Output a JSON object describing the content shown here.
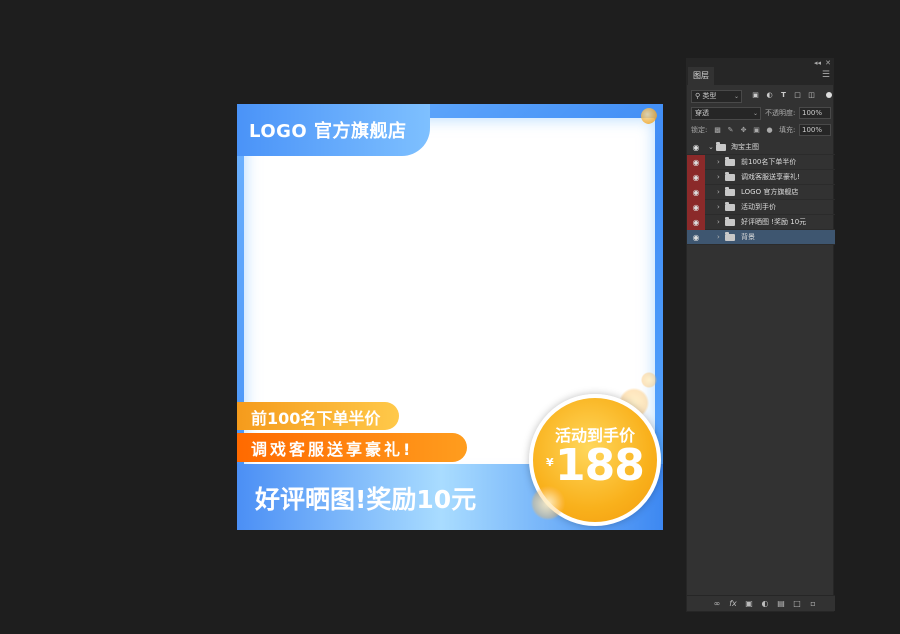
{
  "artwork": {
    "logo_text": "LOGO 官方旗舰店",
    "promo1": "前100名下单半价",
    "promo2": "调戏客服送享豪礼!",
    "bottom_banner": "好评晒图!奖励10元",
    "badge_title": "活动到手价",
    "badge_currency": "¥",
    "badge_price": "188",
    "colors": {
      "primary_blue": "#4a93f8",
      "orange": "#ff7a00",
      "gold": "#f9b11c"
    }
  },
  "layers_panel": {
    "collapse_icon": "double-chevron-icon",
    "close_icon": "close-icon",
    "tab_label": "图层",
    "filter_label": "类型",
    "blend_mode": "穿透",
    "opacity_label": "不透明度:",
    "opacity_value": "100%",
    "lock_label": "锁定:",
    "fill_label": "填充:",
    "fill_value": "100%",
    "group_name": "淘宝主图",
    "layers": [
      {
        "name": "前100名下单半价",
        "highlighted": true
      },
      {
        "name": "调戏客服送享豪礼!",
        "highlighted": true
      },
      {
        "name": "LOGO 官方旗舰店",
        "highlighted": true
      },
      {
        "name": "活动到手价",
        "highlighted": true
      },
      {
        "name": "好评晒图 !奖励 10元",
        "highlighted": true
      },
      {
        "name": "背景",
        "highlighted": false,
        "selected": true
      }
    ],
    "footer_icons": [
      "link-icon",
      "fx-icon",
      "mask-icon",
      "adjustment-icon",
      "new-group-icon",
      "new-layer-icon",
      "delete-icon"
    ]
  }
}
